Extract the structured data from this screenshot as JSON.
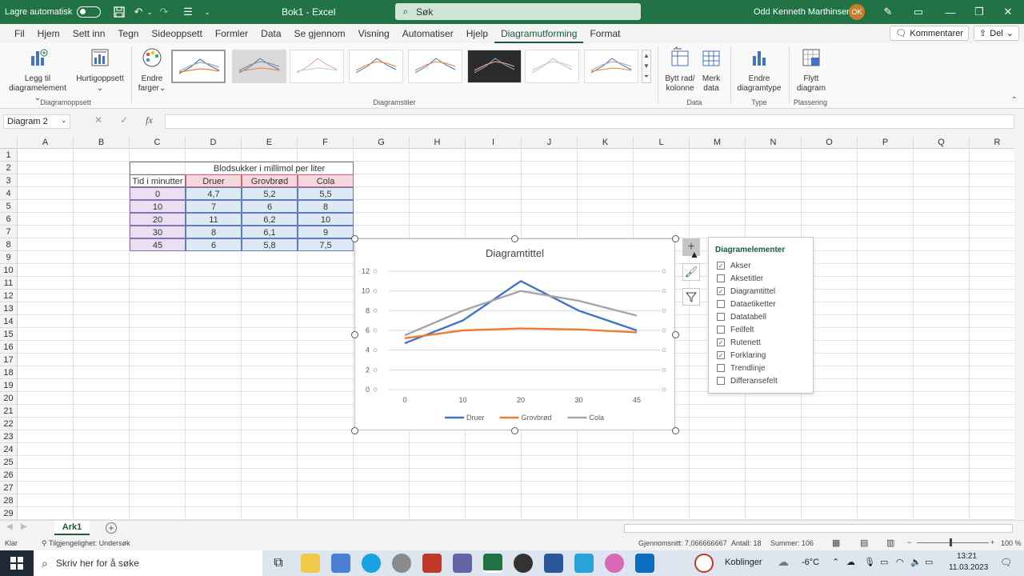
{
  "titlebar": {
    "autosave_label": "Lagre automatisk",
    "document": "Bok1  -  Excel",
    "search_placeholder": "Søk",
    "user_name": "Odd Kenneth Marthinsen",
    "user_initials": "OK"
  },
  "menu": {
    "tabs": [
      "Fil",
      "Hjem",
      "Sett inn",
      "Tegn",
      "Sideoppsett",
      "Formler",
      "Data",
      "Se gjennom",
      "Visning",
      "Automatiser",
      "Hjelp",
      "Diagramutforming",
      "Format"
    ],
    "active_tab": "Diagramutforming",
    "comments": "Kommentarer",
    "share": "Del"
  },
  "ribbon": {
    "add_element_1": "Legg til",
    "add_element_2": "diagramelement",
    "quick_layout": "Hurtigoppsett",
    "change_colors_1": "Endre",
    "change_colors_2": "farger",
    "switch_1": "Bytt rad/",
    "switch_2": "kolonne",
    "select_data_1": "Merk",
    "select_data_2": "data",
    "change_type_1": "Endre",
    "change_type_2": "diagramtype",
    "move_1": "Flytt",
    "move_2": "diagram",
    "group_layouts": "Diagramoppsett",
    "group_styles": "Diagramstiler",
    "group_data": "Data",
    "group_type": "Type",
    "group_location": "Plassering"
  },
  "formula": {
    "namebox": "Diagram 2",
    "fx": "fx",
    "content": ""
  },
  "columns": [
    "A",
    "B",
    "C",
    "D",
    "E",
    "F",
    "G",
    "H",
    "I",
    "J",
    "K",
    "L",
    "M",
    "N",
    "O",
    "P",
    "Q",
    "R"
  ],
  "rows": [
    "1",
    "2",
    "3",
    "4",
    "5",
    "6",
    "7",
    "8",
    "9",
    "10",
    "11",
    "12",
    "13",
    "14",
    "15",
    "16",
    "17",
    "18",
    "19",
    "20",
    "21",
    "22",
    "23",
    "24",
    "25",
    "26",
    "27",
    "28",
    "29"
  ],
  "table": {
    "header_group": "Blodsukker i millimol per liter",
    "col_time": "Tid i minutter",
    "col_names": [
      "Druer",
      "Grovbrød",
      "Cola"
    ],
    "rows": [
      [
        "0",
        "4,7",
        "5,2",
        "5,5"
      ],
      [
        "10",
        "7",
        "6",
        "8"
      ],
      [
        "20",
        "11",
        "6,2",
        "10"
      ],
      [
        "30",
        "8",
        "6,1",
        "9"
      ],
      [
        "45",
        "6",
        "5,8",
        "7,5"
      ]
    ]
  },
  "chart_data": {
    "type": "line",
    "title": "Diagramtittel",
    "categories": [
      "0",
      "10",
      "20",
      "30",
      "45"
    ],
    "series": [
      {
        "name": "Druer",
        "color": "#4472c4",
        "values": [
          4.7,
          7,
          11,
          8,
          6
        ]
      },
      {
        "name": "Grovbrød",
        "color": "#ed7d31",
        "values": [
          5.2,
          6,
          6.2,
          6.1,
          5.8
        ]
      },
      {
        "name": "Cola",
        "color": "#a5a5a5",
        "values": [
          5.5,
          8,
          10,
          9,
          7.5
        ]
      }
    ],
    "ylim": [
      0,
      12
    ],
    "yticks": [
      "0",
      "2",
      "4",
      "6",
      "8",
      "10",
      "12"
    ],
    "grid": true,
    "legend": "bottom"
  },
  "chart_elements": {
    "title": "Diagramelementer",
    "items": [
      {
        "label": "Akser",
        "checked": true
      },
      {
        "label": "Aksetitler",
        "checked": false
      },
      {
        "label": "Diagramtittel",
        "checked": true
      },
      {
        "label": "Dataetiketter",
        "checked": false
      },
      {
        "label": "Datatabell",
        "checked": false
      },
      {
        "label": "Feilfelt",
        "checked": false
      },
      {
        "label": "Rutenett",
        "checked": true
      },
      {
        "label": "Forklaring",
        "checked": true
      },
      {
        "label": "Trendlinje",
        "checked": false
      },
      {
        "label": "Differansefelt",
        "checked": false
      }
    ]
  },
  "sheet_tab": "Ark1",
  "status": {
    "ready": "Klar",
    "accessibility": "Tilgjengelighet: Undersøk",
    "average": "Gjennomsnitt: 7,066666667",
    "count": "Antall: 18",
    "sum": "Summer: 106",
    "zoom": "100 %"
  },
  "taskbar": {
    "search": "Skriv her for å søke",
    "network": "Koblinger",
    "temp": "-6°C",
    "time": "13:21",
    "date": "11.03.2023"
  }
}
